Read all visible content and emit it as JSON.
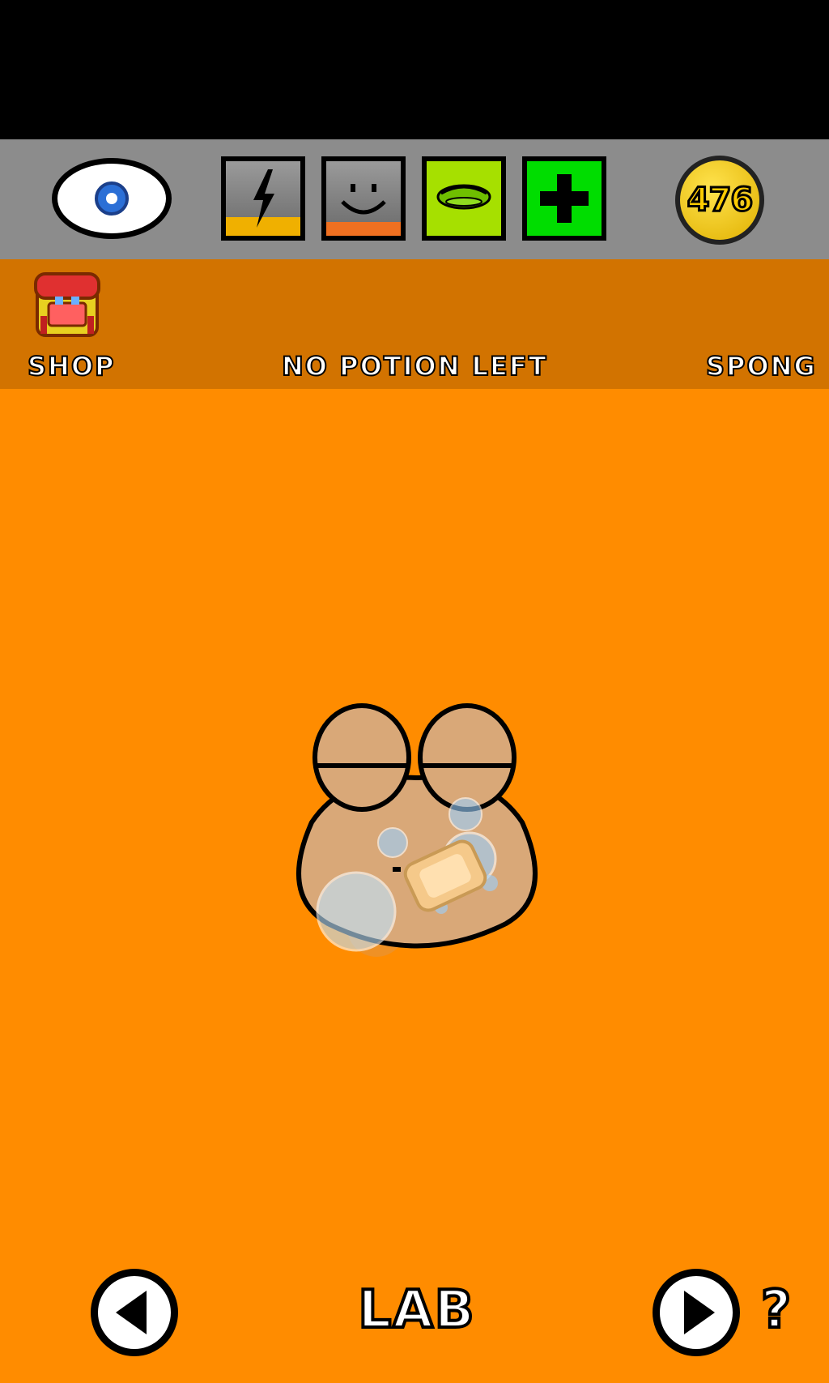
{
  "status": {
    "energy_icon": "lightning-bolt-icon",
    "happiness_icon": "smiley-face-icon",
    "hunger_icon": "food-icon",
    "health_icon": "green-cross-icon",
    "energy_level": 0.25,
    "happiness_level": 0.18,
    "hunger_level": 1.0,
    "health_level": 1.0,
    "coins": "476"
  },
  "room_bar": {
    "shop_label": "SHOP",
    "center_label": "NO POTION LEFT",
    "right_label": "SPONG"
  },
  "bottom_nav": {
    "room_title": "LAB",
    "help_label": "?"
  },
  "colors": {
    "background": "#FF8C00",
    "room_bar": "#D27300",
    "status_bar": "#8C8C8C",
    "energy_fill": "#F0B000",
    "happiness_fill": "#F07020",
    "hunger_fill": "#A6E000",
    "health_fill": "#00DD00"
  }
}
